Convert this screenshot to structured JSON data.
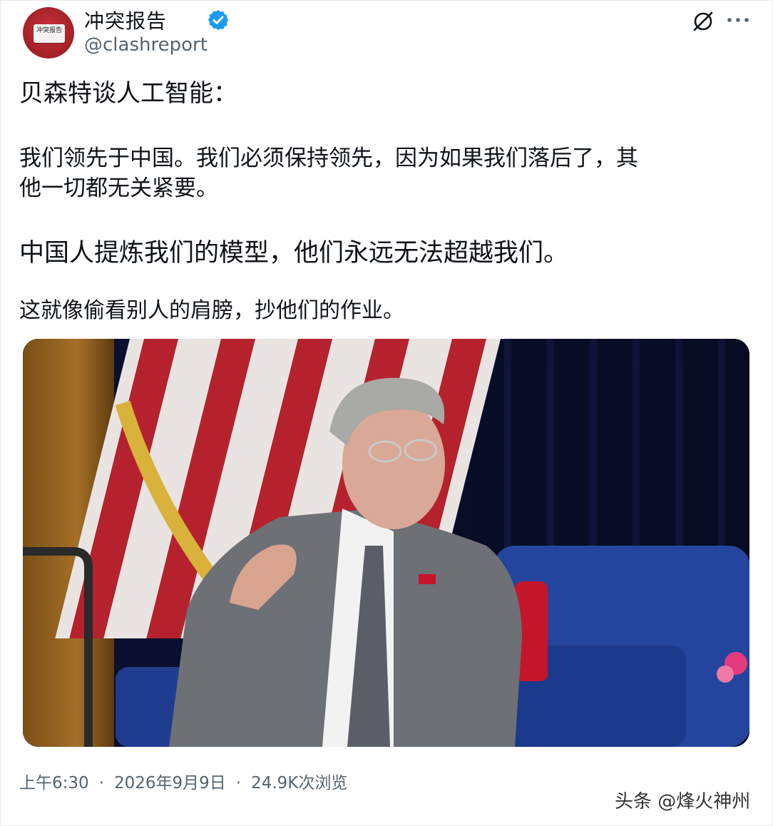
{
  "author": {
    "name": "冲突报告",
    "handle": "@clashreport",
    "avatar_text": "冲突报告",
    "verified_color": "#1d9bf0"
  },
  "header_icons": [
    "grok-icon",
    "more-icon"
  ],
  "post": {
    "title": "贝森特谈人工智能：",
    "paragraph1_line1": "我们领先于中国。我们必须保持领先，因为如果我们落后了，其",
    "paragraph1_line2": "他一切都无关紧要。",
    "paragraph2": "中国人提炼我们的模型，他们永远无法超越我们。",
    "paragraph3": "这就像偷看别人的肩膀，抄他们的作业。"
  },
  "meta": {
    "time": "上午6:30",
    "date": "2026年9月9日",
    "views": "24.9K次浏览"
  },
  "watermark": "头条 @烽火神州",
  "colors": {
    "text": "#0f1419",
    "secondary": "#536471",
    "avatar_red": "#a31f27"
  }
}
